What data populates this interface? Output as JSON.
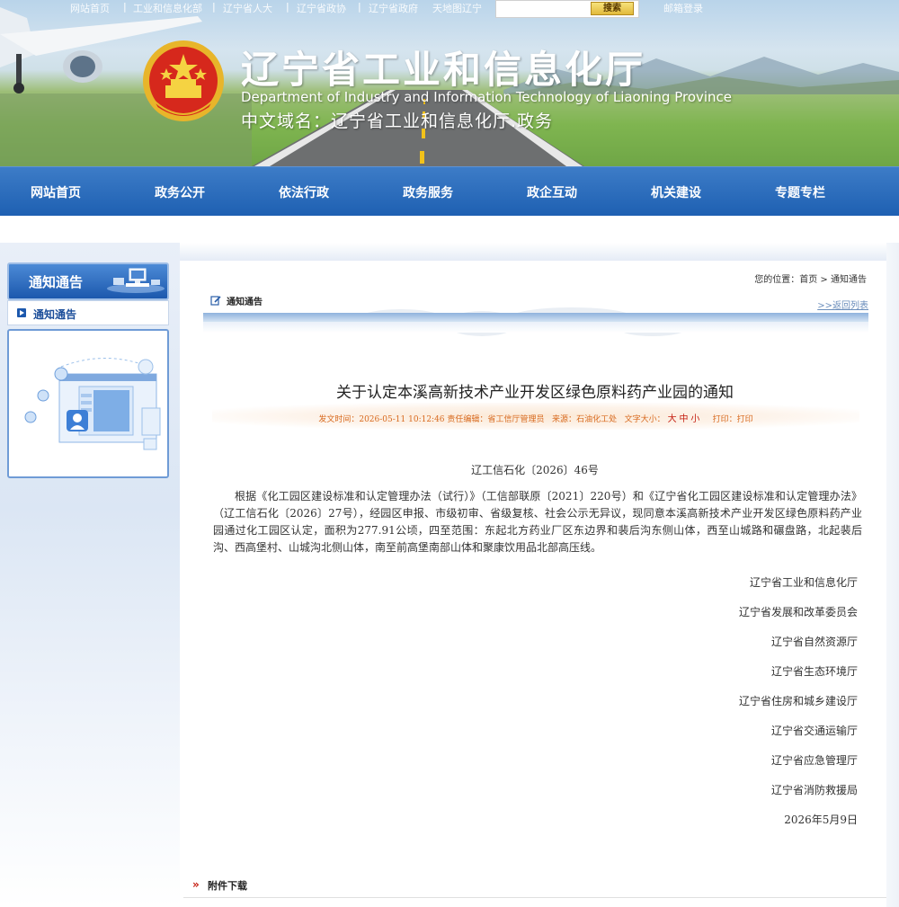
{
  "topbar": {
    "links": [
      "网站首页",
      "工业和信息化部",
      "辽宁省人大",
      "辽宁省政协",
      "辽宁省政府",
      "天地图辽宁"
    ],
    "search_button": "搜索",
    "extra_link": "邮箱登录"
  },
  "header": {
    "title": "辽宁省工业和信息化厅",
    "subtitle": "Department of Industry and Information Technology of Liaoning Province",
    "domain": "中文域名：辽宁省工业和信息化厅.政务"
  },
  "nav": {
    "items": [
      "网站首页",
      "政务公开",
      "依法行政",
      "政务服务",
      "政企互动",
      "机关建设",
      "专题专栏"
    ]
  },
  "sidebar": {
    "heading": "通知通告",
    "items": [
      {
        "label": "通知通告"
      }
    ]
  },
  "breadcrumb": {
    "prefix": "您的位置：",
    "home": "首页",
    "sep": ">",
    "current": "通知通告"
  },
  "column": {
    "title": "通知通告",
    "back_link": ">>返回列表"
  },
  "article": {
    "title": "关于认定本溪高新技术产业开发区绿色原料药产业园的通知",
    "meta": {
      "published_label": "发文时间：",
      "published": "2026-05-11 10:12:46",
      "editor_label": "责任编辑：",
      "editor": "省工信厅管理员",
      "source_label": "来源：",
      "source": "石油化工处",
      "font_size_label": "文字大小：",
      "size_large": "大",
      "size_medium": "中",
      "size_small": "小",
      "print_label": "打印：",
      "print": "打印"
    },
    "doc_number": "辽工信石化〔2026〕46号",
    "body": "根据《化工园区建设标准和认定管理办法（试行）》（工信部联原〔2021〕220号）和《辽宁省化工园区建设标准和认定管理办法》（辽工信石化〔2026〕27号），经园区申报、市级初审、省级复核、社会公示无异议，现同意本溪高新技术产业开发区绿色原料药产业园通过化工园区认定，面积为277.91公顷，四至范围：东起北方药业厂区东边界和裴后沟东侧山体，西至山城路和碾盘路，北起裴后沟、西高堡村、山城沟北侧山体，南至前高堡南部山体和聚康饮用品北部高压线。",
    "signatories": [
      "辽宁省工业和信息化厅",
      "辽宁省发展和改革委员会",
      "辽宁省自然资源厅",
      "辽宁省生态环境厅",
      "辽宁省住房和城乡建设厅",
      "辽宁省交通运输厅",
      "辽宁省应急管理厅",
      "辽宁省消防救援局"
    ],
    "date": "2026年5月9日"
  },
  "attachments": {
    "icon": "»",
    "title": "附件下载"
  },
  "colors": {
    "nav_blue": "#1e60b2",
    "meta_orange": "#d86a1f",
    "size_red": "#c41c0f"
  }
}
